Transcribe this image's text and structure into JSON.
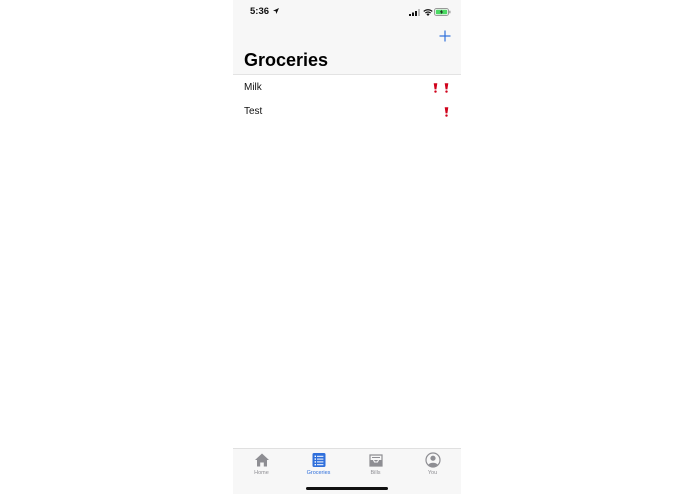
{
  "status_bar": {
    "time": "5:36",
    "icons": [
      "location-arrow-icon",
      "cellular-signal-icon",
      "wifi-icon",
      "battery-charging-icon"
    ]
  },
  "nav": {
    "title": "Groceries",
    "add_icon": "plus-icon"
  },
  "list": {
    "items": [
      {
        "name": "Milk",
        "priority": 2
      },
      {
        "name": "Test",
        "priority": 1
      }
    ],
    "priority_icon": "exclamation-icon"
  },
  "tabs": [
    {
      "label": "Home",
      "icon": "house-icon",
      "active": false
    },
    {
      "label": "Groceries",
      "icon": "list-icon",
      "active": true
    },
    {
      "label": "Bills",
      "icon": "inbox-tray-icon",
      "active": false
    },
    {
      "label": "You",
      "icon": "person-circle-icon",
      "active": false
    }
  ],
  "colors": {
    "accent": "#2f6fdb",
    "priority": "#d0021b",
    "inactive_tab": "#8e8e93",
    "bar_background": "#f7f7f7"
  }
}
